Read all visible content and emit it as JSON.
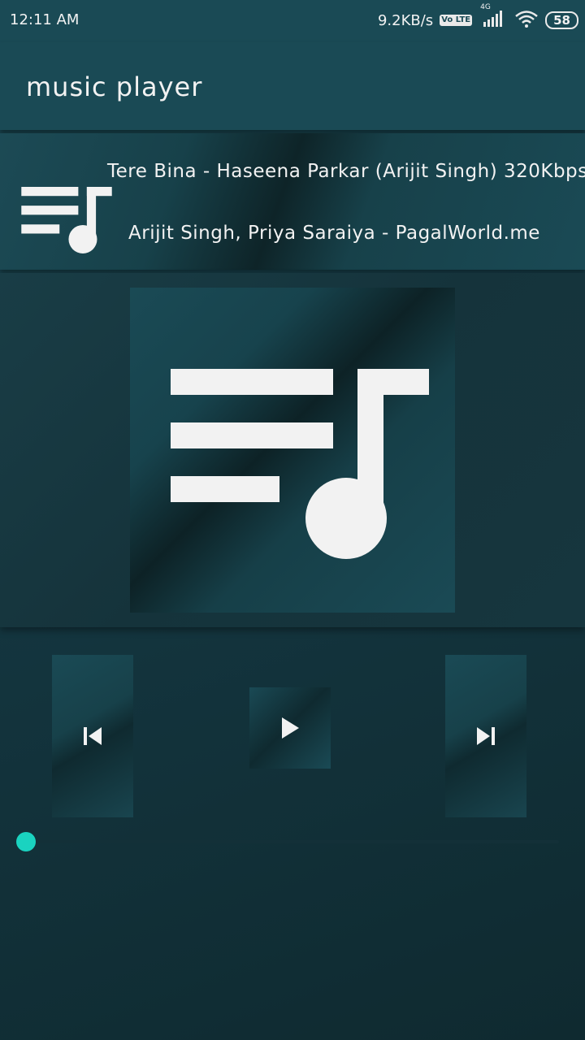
{
  "status_bar": {
    "time": "12:11 AM",
    "network_speed": "9.2KB/s",
    "volte_label": "Vo LTE",
    "network_type": "4G",
    "battery": "58",
    "icons": [
      "volte-icon",
      "signal-icon",
      "wifi-icon",
      "battery-icon"
    ]
  },
  "app_bar": {
    "title": "music player"
  },
  "now_playing": {
    "title": "Tere Bina - Haseena Parkar (Arijit Singh) 320Kbps",
    "artist": "Arijit Singh, Priya Saraiya - PagalWorld.me",
    "icon": "playlist-music-icon"
  },
  "album_art": {
    "icon": "playlist-music-icon"
  },
  "controls": {
    "previous_icon": "skip-previous-icon",
    "play_icon": "play-icon",
    "next_icon": "skip-next-icon"
  },
  "seek": {
    "progress_fraction": 0.0
  },
  "colors": {
    "bar": "#1a4a55",
    "accent": "#1ad3c0",
    "text": "#f2f2f2"
  }
}
